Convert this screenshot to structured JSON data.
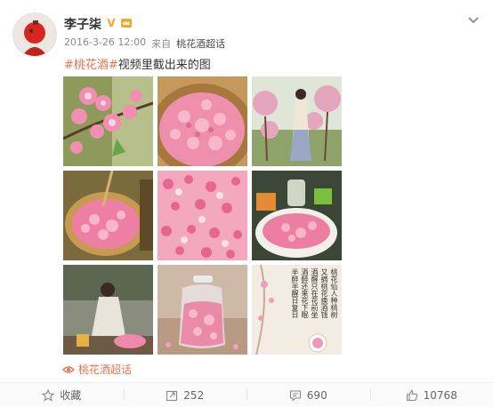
{
  "post": {
    "username": "李子柒",
    "timestamp": "2016-3-26 12:00",
    "source_label": "来自",
    "source_name": "桃花酒超话",
    "hashtag": "#桃花酒#",
    "text": "视频里截出来的图",
    "location": "桃花酒超话"
  },
  "images": [
    {
      "name": "peach-blossom-branch"
    },
    {
      "name": "petals-in-basket"
    },
    {
      "name": "girl-in-orchard"
    },
    {
      "name": "petals-bamboo-basket"
    },
    {
      "name": "petal-pile"
    },
    {
      "name": "petals-in-bowl"
    },
    {
      "name": "girl-preparing-petals"
    },
    {
      "name": "petals-in-glass-jar"
    },
    {
      "name": "calligraphy-poem"
    }
  ],
  "calligraphy": {
    "col1": "桃花仙人种桃树",
    "col2": "又摘桃花换酒钱",
    "col3": "酒醒只在花前坐",
    "col4": "酒醉还来花下眠",
    "col5": "半醉半醒日复日"
  },
  "actions": {
    "favorite": "收藏",
    "repost": "252",
    "comment": "690",
    "like": "10768"
  },
  "colors": {
    "accent": "#eb7350",
    "badge": "#f5a623"
  },
  "icons": {
    "verified": "v-badge-icon",
    "member": "crown-icon",
    "more": "chevron-down-icon",
    "location": "eye-location-icon",
    "favorite": "star-icon",
    "repost": "repost-icon",
    "comment": "comment-icon",
    "like": "thumbs-up-icon"
  }
}
